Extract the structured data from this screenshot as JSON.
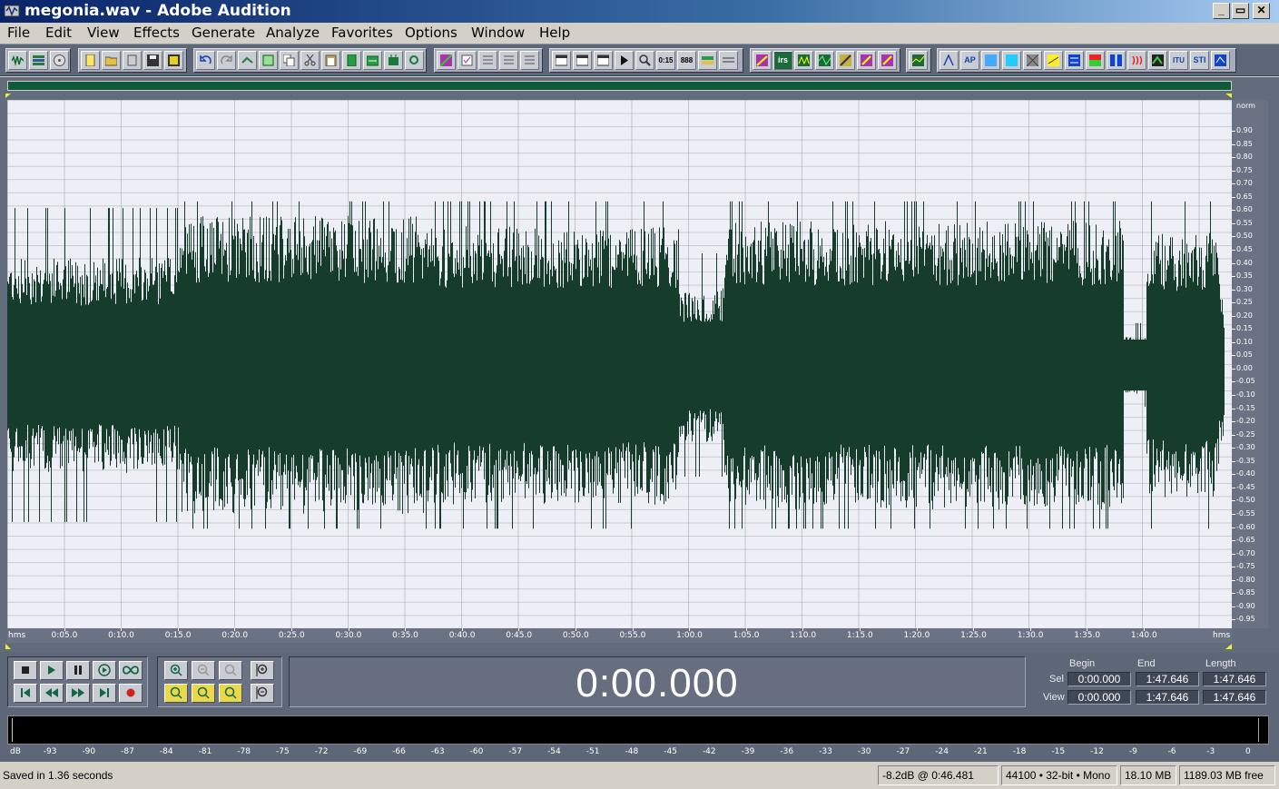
{
  "window": {
    "title": "megonia.wav - Adobe Audition",
    "controls": {
      "minimize": "_",
      "restore": "▭",
      "close": "✕"
    }
  },
  "menu": [
    "File",
    "Edit",
    "View",
    "Effects",
    "Generate",
    "Analyze",
    "Favorites",
    "Options",
    "Window",
    "Help"
  ],
  "toolbar": {
    "labeled_buttons": {
      "time": "0:15",
      "seq": "888",
      "irs": "irs",
      "ap": "AP",
      "itu": "ITU",
      "sti": "STI"
    }
  },
  "waveform": {
    "color": "#163d2b",
    "background": "#eeeff6",
    "amplitude_unit": "norm",
    "amplitude_labels": [
      "0.90",
      "0.85",
      "0.80",
      "0.75",
      "0.70",
      "0.65",
      "0.60",
      "0.55",
      "0.50",
      "0.45",
      "0.40",
      "0.35",
      "0.30",
      "0.25",
      "0.20",
      "0.15",
      "0.10",
      "0.05",
      "0.00",
      "-0.05",
      "-0.10",
      "-0.15",
      "-0.20",
      "-0.25",
      "-0.30",
      "-0.35",
      "-0.40",
      "-0.45",
      "-0.50",
      "-0.55",
      "-0.60",
      "-0.65",
      "-0.70",
      "-0.75",
      "-0.80",
      "-0.85",
      "-0.90",
      "-0.95"
    ],
    "time_unit": "hms",
    "time_labels": [
      "0:05.0",
      "0:10.0",
      "0:15.0",
      "0:20.0",
      "0:25.0",
      "0:30.0",
      "0:35.0",
      "0:40.0",
      "0:45.0",
      "0:50.0",
      "0:55.0",
      "1:00.0",
      "1:05.0",
      "1:10.0",
      "1:15.0",
      "1:20.0",
      "1:25.0",
      "1:30.0",
      "1:35.0",
      "1:40.0"
    ]
  },
  "transport": {
    "clock": "0:00.000",
    "headers": {
      "begin": "Begin",
      "end": "End",
      "length": "Length"
    },
    "sel": {
      "label": "Sel",
      "begin": "0:00.000",
      "end": "1:47.646",
      "length": "1:47.646"
    },
    "view": {
      "label": "View",
      "begin": "0:00.000",
      "end": "1:47.646",
      "length": "1:47.646"
    }
  },
  "meter": {
    "labels": [
      "dB",
      "-93",
      "-90",
      "-87",
      "-84",
      "-81",
      "-78",
      "-75",
      "-72",
      "-69",
      "-66",
      "-63",
      "-60",
      "-57",
      "-54",
      "-51",
      "-48",
      "-45",
      "-42",
      "-39",
      "-36",
      "-33",
      "-30",
      "-27",
      "-24",
      "-21",
      "-18",
      "-15",
      "-12",
      "-9",
      "-6",
      "-3",
      "0"
    ]
  },
  "status": {
    "message": "Saved in 1.36 seconds",
    "level_at": "-8.2dB @   0:46.481",
    "format": "44100 • 32-bit • Mono",
    "file_size": "18.10 MB",
    "free_space": "1189.03 MB free"
  }
}
